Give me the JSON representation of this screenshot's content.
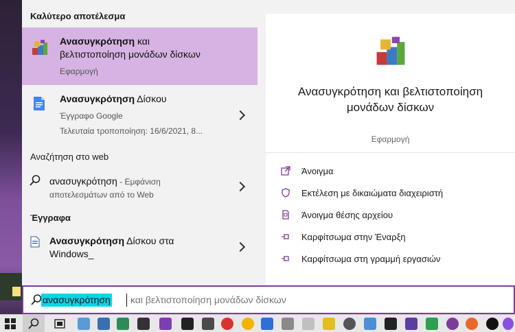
{
  "results": {
    "best_header": "Καλύτερο αποτέλεσμα",
    "best": {
      "title_bold": "Ανασυγκρότηση",
      "title_rest_1": " και",
      "title_line2": "βελτιστοποίηση μονάδων δίσκων",
      "subtitle": "Εφαρμογή",
      "icon": "defrag-app-icon"
    },
    "doc": {
      "title_bold": "Ανασυγκρότηση",
      "title_rest": " Δίσκου",
      "subtitle": "Έγγραφο Google",
      "modified": "Τελευταία τροποποίηση: 16/6/2021, 8...",
      "icon": "google-doc-icon"
    },
    "web_header": "Αναζήτηση στο web",
    "web": {
      "query": "ανασυγκρότηση",
      "suffix": " - Εμφάνιση",
      "line2": "αποτελεσμάτων από το Web",
      "icon": "search-icon"
    },
    "docs_header": "Έγγραφα",
    "doc2": {
      "title_bold": "Ανασυγκρότηση",
      "title_rest": " Δίσκου στα",
      "line2": "Windows_",
      "icon": "document-icon"
    }
  },
  "detail": {
    "name_line1": "Ανασυγκρότηση και βελτιστοποίηση",
    "name_line2": "μονάδων δίσκων",
    "type": "Εφαρμογή",
    "actions": [
      {
        "label": "Άνοιγμα",
        "icon": "open-icon"
      },
      {
        "label": "Εκτέλεση με δικαιώματα διαχειριστή",
        "icon": "shield-icon"
      },
      {
        "label": "Άνοιγμα θέσης αρχείου",
        "icon": "file-location-icon"
      },
      {
        "label": "Καρφίτσωμα στην Έναρξη",
        "icon": "pin-icon"
      },
      {
        "label": "Καρφίτσωμα στη γραμμή εργασιών",
        "icon": "pin-icon"
      }
    ]
  },
  "search": {
    "typed": "ανασυγκρότηση",
    "completion": "και βελτιστοποίηση μονάδων δίσκων"
  },
  "colors": {
    "accent": "#7d3c98",
    "best_highlight": "#d6b3e2",
    "typed_highlight": "#00d7e6"
  }
}
